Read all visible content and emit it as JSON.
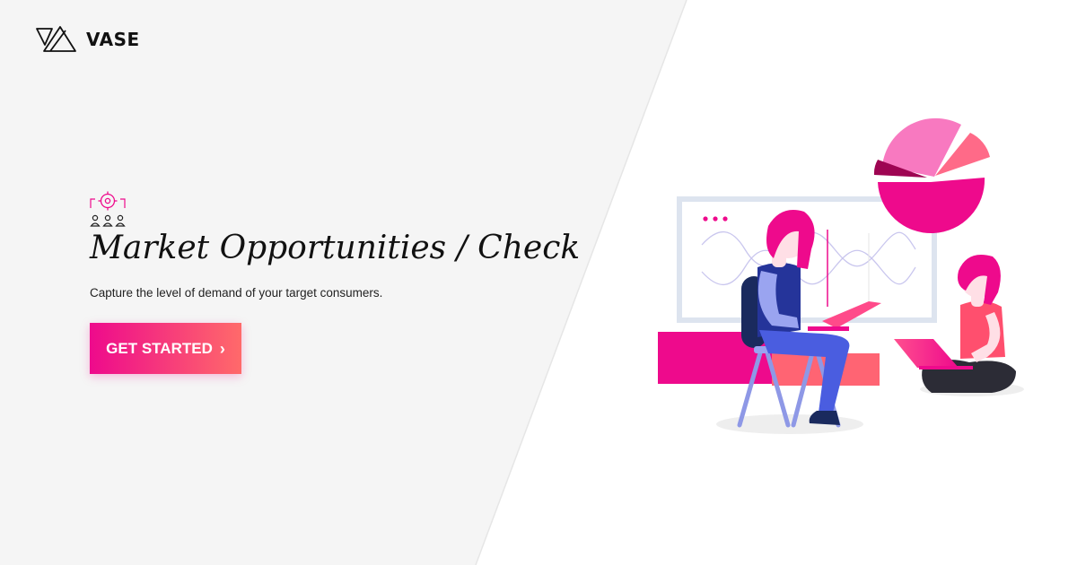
{
  "brand": {
    "name": "VASE",
    "logo_icon": "vase-triangles-logo-icon"
  },
  "hero": {
    "icon": "target-audience-icon",
    "title": "Market Opportunities / Check",
    "subtitle": "Capture the level of demand of your target consumers.",
    "cta_label": "GET STARTED",
    "cta_icon": "chevron-right-icon"
  },
  "colors": {
    "accent_pink": "#ee0a8c",
    "accent_coral": "#ff6a6a",
    "text_dark": "#111111",
    "panel_grey": "#f5f5f5"
  },
  "illustration": {
    "name": "people-analyzing-data-illustration",
    "pie_chart": {
      "slices": 4
    }
  }
}
